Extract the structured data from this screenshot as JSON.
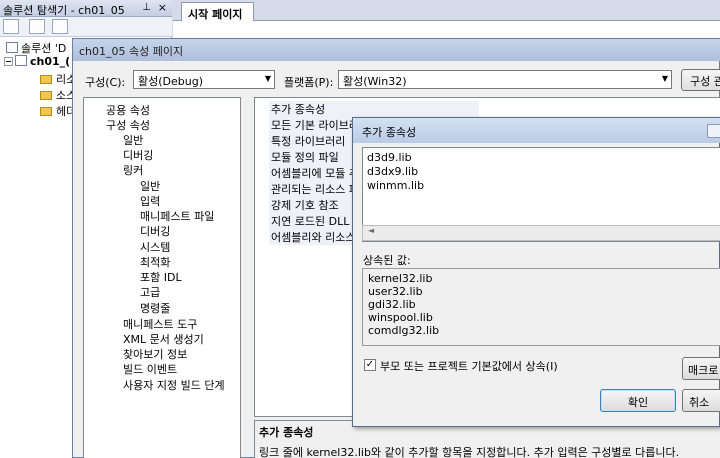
{
  "solution_explorer": {
    "title": "솔루션 탐색기 - ch01_05",
    "pin": "ᵮ",
    "close": "×",
    "tree": {
      "solution": "솔루션 'D",
      "project": "ch01_(",
      "folders": [
        "리소",
        "소스",
        "헤더"
      ]
    }
  },
  "doc_tabs": {
    "start_page": "시작 페이지"
  },
  "property_pages": {
    "title": "ch01_05 속성 페이지",
    "config_label": "구성(C):",
    "config_value": "활성(Debug)",
    "platform_label": "플랫폼(P):",
    "platform_value": "활성(Win32)",
    "config_manager_button": "구성 관",
    "nav": [
      {
        "label": "공용 속성",
        "level": 1
      },
      {
        "label": "구성 속성",
        "level": 1
      },
      {
        "label": "일반",
        "level": 2
      },
      {
        "label": "디버깅",
        "level": 2
      },
      {
        "label": "링커",
        "level": 2
      },
      {
        "label": "일반",
        "level": 3
      },
      {
        "label": "입력",
        "level": 3
      },
      {
        "label": "매니페스트 파일",
        "level": 3
      },
      {
        "label": "디버깅",
        "level": 3
      },
      {
        "label": "시스템",
        "level": 3
      },
      {
        "label": "최적화",
        "level": 3
      },
      {
        "label": "포함 IDL",
        "level": 3
      },
      {
        "label": "고급",
        "level": 3
      },
      {
        "label": "명령줄",
        "level": 3
      },
      {
        "label": "매니페스트 도구",
        "level": 2
      },
      {
        "label": "XML 문서 생성기",
        "level": 2
      },
      {
        "label": "찾아보기 정보",
        "level": 2
      },
      {
        "label": "빌드 이벤트",
        "level": 2
      },
      {
        "label": "사용자 지정 빌드 단계",
        "level": 2
      }
    ],
    "grid_rows": [
      "추가 종속성",
      "모든 기본 라이브러",
      "특정 라이브러리 ",
      "모듈 정의 파일",
      "어셈블리에 모듈 추",
      "관리되는 리소스 파",
      "강제 기호 참조",
      "지연 로드된 DLL",
      "어셈블리와 리소스"
    ],
    "description": {
      "title": "추가 종속성",
      "text": "링크 줄에 kernel32.lib와 같이 추가할 항목을 지정합니다. 추가 입력은 구성별로 다릅니다."
    }
  },
  "add_dependencies_dialog": {
    "title": "추가 종속성",
    "entries": [
      "d3d9.lib",
      "d3dx9.lib",
      "winmm.lib"
    ],
    "inherited_label": "상속된 값:",
    "inherited_values": [
      "kernel32.lib",
      "user32.lib",
      "gdi32.lib",
      "winspool.lib",
      "comdlg32.lib"
    ],
    "inherit_checkbox_label": "부모 또는 프로젝트 기본값에서 상속(I)",
    "inherit_checked": true,
    "macro_button": "매크로",
    "ok_button": "확인",
    "cancel_button": "취소"
  }
}
